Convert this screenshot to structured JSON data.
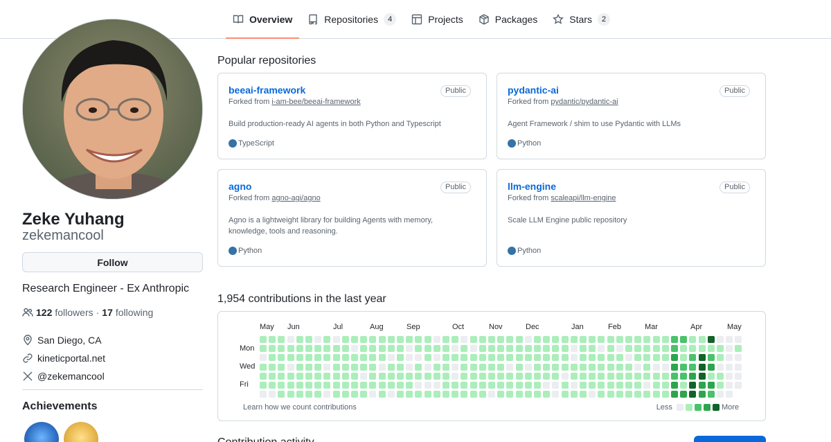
{
  "tabs": [
    {
      "label": "Overview",
      "icon": "book-icon",
      "active": true
    },
    {
      "label": "Repositories",
      "icon": "repo-icon",
      "count": "4"
    },
    {
      "label": "Projects",
      "icon": "table-icon"
    },
    {
      "label": "Packages",
      "icon": "package-icon"
    },
    {
      "label": "Stars",
      "icon": "star-icon",
      "count": "2"
    }
  ],
  "profile": {
    "name": "Zeke Yuhang",
    "login": "zekemancool",
    "follow_label": "Follow",
    "bio": "Research Engineer - Ex Anthropic",
    "followers_count": "122",
    "followers_label": "followers",
    "separator": "·",
    "following_count": "17",
    "following_label": "following",
    "location": "San Diego, CA",
    "website": "kineticportal.net",
    "twitter": "@zekemancool"
  },
  "achievements": {
    "title": "Achievements"
  },
  "popular": {
    "title": "Popular repositories",
    "repos": [
      {
        "name": "beeai-framework",
        "visibility": "Public",
        "forked_prefix": "Forked from",
        "forked_from": "i-am-bee/beeai-framework",
        "description": "Build production-ready AI agents in both Python and Typescript",
        "language": "TypeScript",
        "language_color": "#3178c6"
      },
      {
        "name": "pydantic-ai",
        "visibility": "Public",
        "forked_prefix": "Forked from",
        "forked_from": "pydantic/pydantic-ai",
        "description": "Agent Framework / shim to use Pydantic with LLMs",
        "language": "Python",
        "language_color": "#3572A5"
      },
      {
        "name": "agno",
        "visibility": "Public",
        "forked_prefix": "Forked from",
        "forked_from": "agno-agi/agno",
        "description": "Agno is a lightweight library for building Agents with memory, knowledge, tools and reasoning.",
        "language": "Python",
        "language_color": "#3572A5"
      },
      {
        "name": "llm-engine",
        "visibility": "Public",
        "forked_prefix": "Forked from",
        "forked_from": "scaleapi/llm-engine",
        "description": "Scale LLM Engine public repository",
        "language": "Python",
        "language_color": "#3572A5"
      }
    ]
  },
  "contributions": {
    "title": "1,954 contributions in the last year",
    "months": [
      "May",
      "Jun",
      "Jul",
      "Aug",
      "Sep",
      "Oct",
      "Nov",
      "Dec",
      "Jan",
      "Feb",
      "Mar",
      "Apr",
      "May"
    ],
    "days": [
      "Mon",
      "Wed",
      "Fri"
    ],
    "learn_label": "Learn how we count contributions",
    "less_label": "Less",
    "more_label": "More",
    "level_colors": [
      "#ebedf0",
      "#aceebb",
      "#4ac26b",
      "#2da44e",
      "#116329"
    ]
  },
  "activity": {
    "title": "Contribution activity"
  }
}
